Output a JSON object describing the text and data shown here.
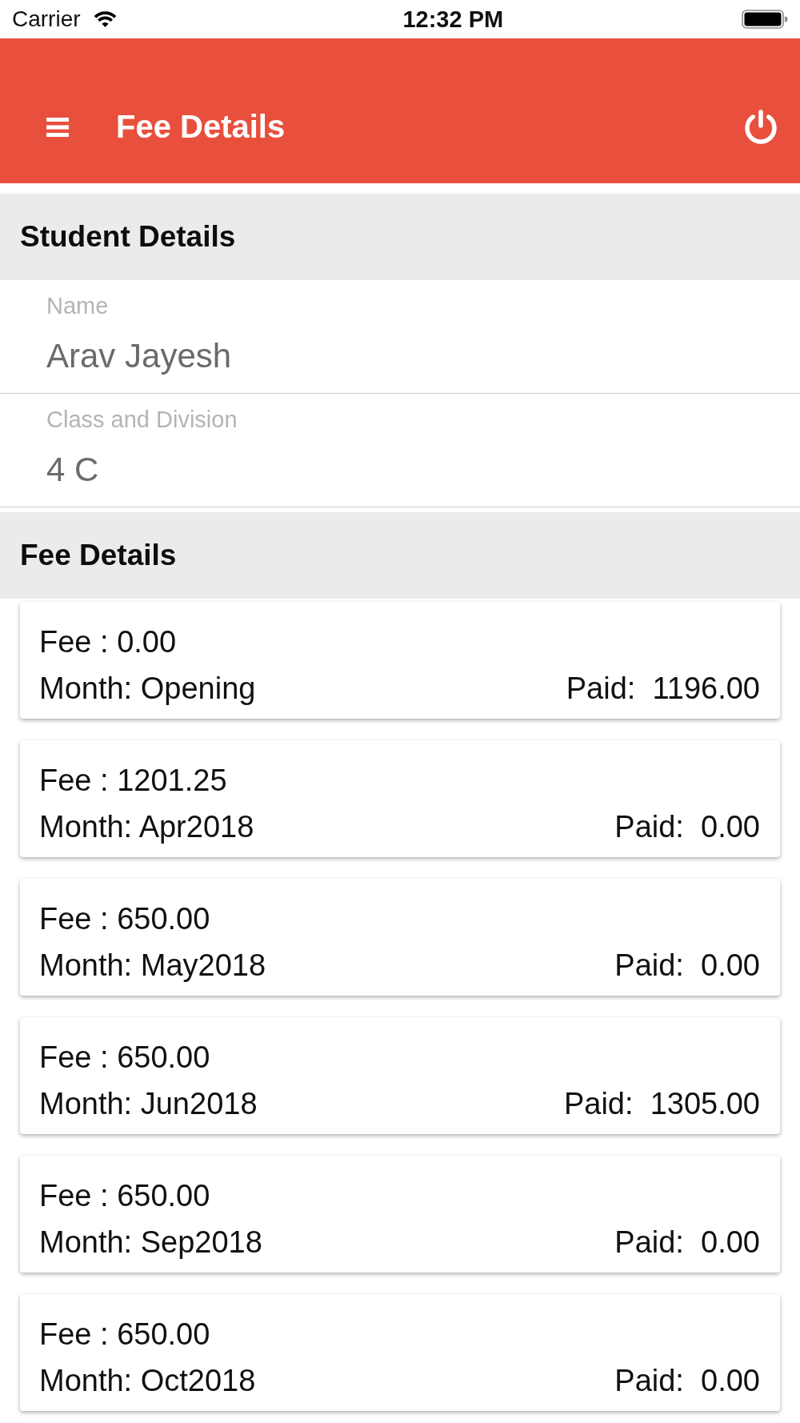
{
  "status_bar": {
    "carrier": "Carrier",
    "time": "12:32 PM"
  },
  "app_bar": {
    "title": "Fee Details"
  },
  "student_details": {
    "heading": "Student Details",
    "fields": [
      {
        "label": "Name",
        "value": "Arav Jayesh"
      },
      {
        "label": "Class and Division",
        "value": "4 C"
      }
    ]
  },
  "fee_details": {
    "heading": "Fee Details",
    "items": [
      {
        "fee": "Fee : 0.00",
        "month": "Month: Opening",
        "paid": "Paid:  1196.00"
      },
      {
        "fee": "Fee : 1201.25",
        "month": "Month: Apr2018",
        "paid": "Paid:  0.00"
      },
      {
        "fee": "Fee : 650.00",
        "month": "Month: May2018",
        "paid": "Paid:  0.00"
      },
      {
        "fee": "Fee : 650.00",
        "month": "Month: Jun2018",
        "paid": "Paid:  1305.00"
      },
      {
        "fee": "Fee : 650.00",
        "month": "Month: Sep2018",
        "paid": "Paid:  0.00"
      },
      {
        "fee": "Fee : 650.00",
        "month": "Month: Oct2018",
        "paid": "Paid:  0.00"
      }
    ]
  }
}
